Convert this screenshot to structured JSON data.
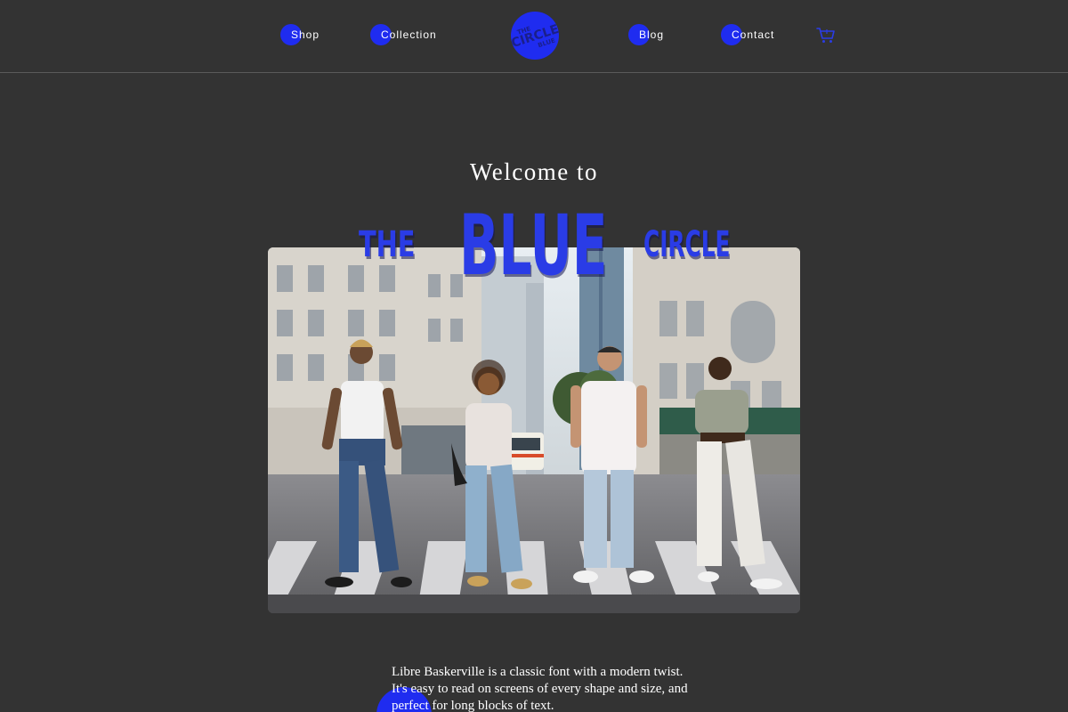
{
  "nav": {
    "items": [
      {
        "label": "Shop"
      },
      {
        "label": "Collection"
      },
      {
        "label": "Blog"
      },
      {
        "label": "Contact"
      }
    ],
    "logo_text": [
      "THE",
      "CIRCLE",
      "BLUE"
    ],
    "cart_icon": "shopping-cart-icon"
  },
  "hero": {
    "welcome": "Welcome to",
    "title_the": "THE",
    "title_blue": "BLUE",
    "title_circle": "CIRCLE",
    "photo": "group-of-four-people-on-city-crosswalk"
  },
  "body": {
    "text": "Libre Baskerville is a classic font with a modern twist. It's easy to read on screens of every shape and size, and perfect for long blocks of text."
  },
  "colors": {
    "background": "#333333",
    "accent": "#1f2cf0",
    "title_blue": "#2a3ce6"
  }
}
